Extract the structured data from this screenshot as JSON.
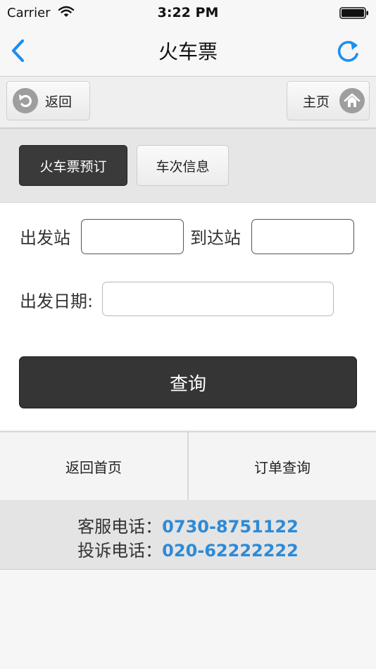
{
  "status_bar": {
    "carrier": "Carrier",
    "time": "3:22 PM"
  },
  "nav_bar": {
    "title": "火车票",
    "back_icon": "chevron-left-icon",
    "refresh_icon": "refresh-icon"
  },
  "toolbar": {
    "back_label": "返回",
    "home_label": "主页",
    "back_icon": "back-circle-icon",
    "home_icon": "home-circle-icon"
  },
  "tabs": [
    {
      "label": "火车票预订",
      "active": true
    },
    {
      "label": "车次信息",
      "active": false
    }
  ],
  "form": {
    "departure_label": "出发站",
    "departure_value": "",
    "arrival_label": "到达站",
    "arrival_value": "",
    "date_label": "出发日期:",
    "date_value": "",
    "submit_label": "查询"
  },
  "bottom_nav": {
    "home_label": "返回首页",
    "orders_label": "订单查询"
  },
  "contact": {
    "service_label": "客服电话：",
    "service_phone": "0730-8751122",
    "complaint_label": "投诉电话：",
    "complaint_phone": "020-62222222"
  },
  "colors": {
    "accent_blue": "#1a8ff0",
    "phone_blue": "#2d8ad6",
    "dark_button": "#353535"
  }
}
